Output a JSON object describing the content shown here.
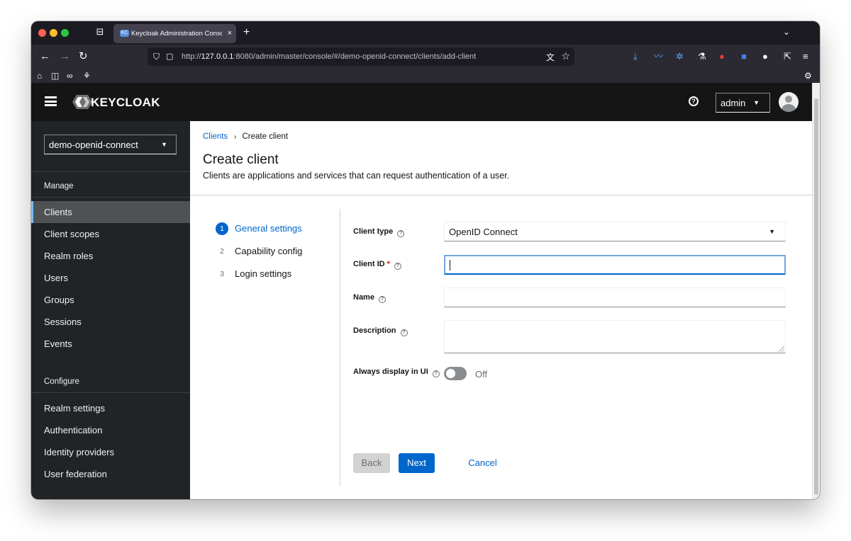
{
  "browser": {
    "tab_title": "Keycloak Administration Console",
    "tab_favicon_label": "KC",
    "tab_close": "×",
    "new_tab": "+",
    "url_prefix": "http://",
    "url_host": "127.0.0.1",
    "url_rest": ":8080/admin/master/console/#/demo-openid-connect/clients/add-client",
    "icons": [
      "back-icon",
      "forward-icon",
      "reload-icon",
      "shield-icon",
      "page-icon",
      "translate-icon",
      "bookmark-star-icon",
      "downloads-icon",
      "extension-icons",
      "share-icon",
      "menu-icon",
      "home-icon",
      "sidebar-icon",
      "settings-icon"
    ]
  },
  "app": {
    "logo_text_bold": "KEYCLOAK",
    "help_label": "?",
    "user_menu_label": "admin"
  },
  "sidebar": {
    "realm": "demo-openid-connect",
    "sections": [
      {
        "title": "Manage",
        "items": [
          "Clients",
          "Client scopes",
          "Realm roles",
          "Users",
          "Groups",
          "Sessions",
          "Events"
        ]
      },
      {
        "title": "Configure",
        "items": [
          "Realm settings",
          "Authentication",
          "Identity providers",
          "User federation"
        ]
      }
    ],
    "active_item": "Clients"
  },
  "main": {
    "breadcrumb": {
      "link": "Clients",
      "separator": "›",
      "current": "Create client"
    },
    "title": "Create client",
    "description": "Clients are applications and services that can request authentication of a user.",
    "wizard_steps": [
      {
        "number": "1",
        "label": "General settings",
        "current": true
      },
      {
        "number": "2",
        "label": "Capability config",
        "current": false
      },
      {
        "number": "3",
        "label": "Login settings",
        "current": false
      }
    ],
    "form": {
      "client_type_label": "Client type",
      "client_type_value": "OpenID Connect",
      "client_id_label": "Client ID",
      "required_marker": "*",
      "client_id_value": "",
      "name_label": "Name",
      "name_value": "",
      "description_label": "Description",
      "description_value": "",
      "always_display_label": "Always display in UI",
      "always_display_state": "Off",
      "help_glyph": "?"
    },
    "buttons": {
      "back": "Back",
      "next": "Next",
      "cancel": "Cancel"
    }
  },
  "colors": {
    "accent": "#0066cc",
    "sidebar_bg": "#212427",
    "masthead_bg": "#151515",
    "active_nav_bg": "#4f5255"
  }
}
